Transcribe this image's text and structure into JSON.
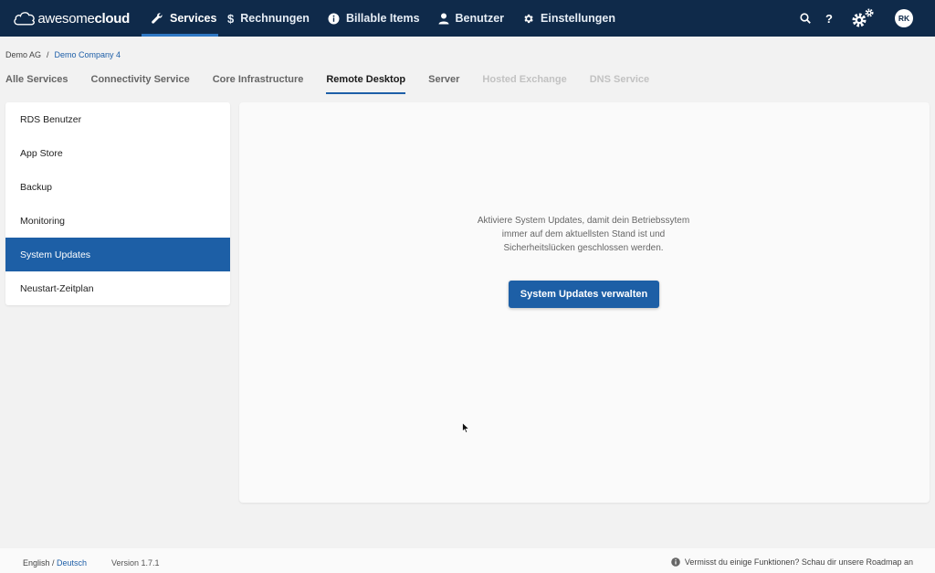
{
  "brand": {
    "name_light": "awesome",
    "name_bold": "cloud"
  },
  "nav": {
    "services": "Services",
    "rechnungen": "Rechnungen",
    "billable": "Billable Items",
    "benutzer": "Benutzer",
    "einstellungen": "Einstellungen"
  },
  "top_right": {
    "help": "?",
    "avatar": "RK"
  },
  "breadcrumb": {
    "root": "Demo AG",
    "sep": "/",
    "current": "Demo Company 4"
  },
  "tabs": {
    "alle": "Alle Services",
    "connectivity": "Connectivity Service",
    "core": "Core Infrastructure",
    "remote": "Remote Desktop",
    "server": "Server",
    "exchange": "Hosted Exchange",
    "dns": "DNS Service"
  },
  "side": {
    "rds": "RDS Benutzer",
    "appstore": "App Store",
    "backup": "Backup",
    "monitoring": "Monitoring",
    "updates": "System Updates",
    "neustart": "Neustart-Zeitplan"
  },
  "panel": {
    "message": "Aktiviere System Updates, damit dein Betriebssytem immer auf dem aktuellsten Stand ist und Sicherheitslücken geschlossen werden.",
    "button": "System Updates verwalten"
  },
  "footer": {
    "lang_en": "English",
    "lang_sep": " / ",
    "lang_de": "Deutsch",
    "version": "Version 1.7.1",
    "roadmap": "Vermisst du einige Funktionen? Schau dir unsere Roadmap an"
  },
  "colors": {
    "navbar": "#0f2a4a",
    "accent": "#1d5fa6"
  }
}
